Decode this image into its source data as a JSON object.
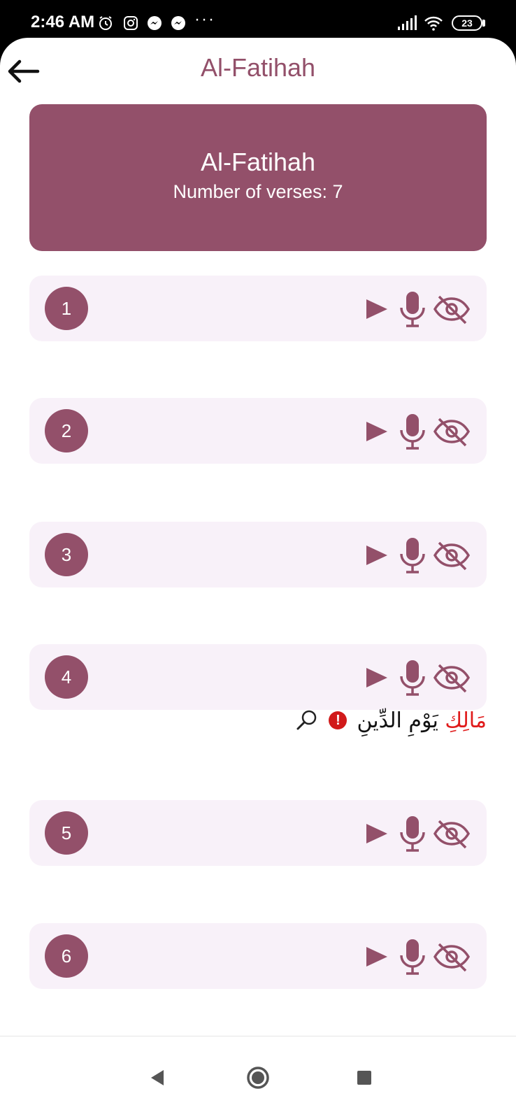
{
  "status_bar": {
    "time": "2:46 AM",
    "overflow": "···",
    "battery": "23",
    "icons": [
      "alarm-icon",
      "instagram-icon",
      "messenger-icon",
      "messenger-icon",
      "signal-icon",
      "wifi-icon",
      "battery-icon"
    ]
  },
  "header": {
    "title": "Al-Fatihah",
    "back_icon": "arrow-left-icon"
  },
  "surah_card": {
    "name": "Al-Fatihah",
    "verses_label": "Number of verses: 7"
  },
  "verses": [
    {
      "number": "1"
    },
    {
      "number": "2"
    },
    {
      "number": "3"
    },
    {
      "number": "4"
    },
    {
      "number": "5"
    },
    {
      "number": "6"
    }
  ],
  "verse_actions": [
    "play-icon",
    "microphone-icon",
    "eye-off-icon"
  ],
  "feedback": {
    "wrong_word": "مَالِكِ",
    "rest_text": "يَوْمِ الدِّينِ",
    "error_mark": "!",
    "zoom_icon": "magnifier-icon"
  },
  "nav": [
    "back-triangle-icon",
    "home-circle-icon",
    "recents-square-icon"
  ],
  "colors": {
    "accent": "#93506a",
    "row_background": "#f8f1f9",
    "error": "#e01b1b"
  }
}
